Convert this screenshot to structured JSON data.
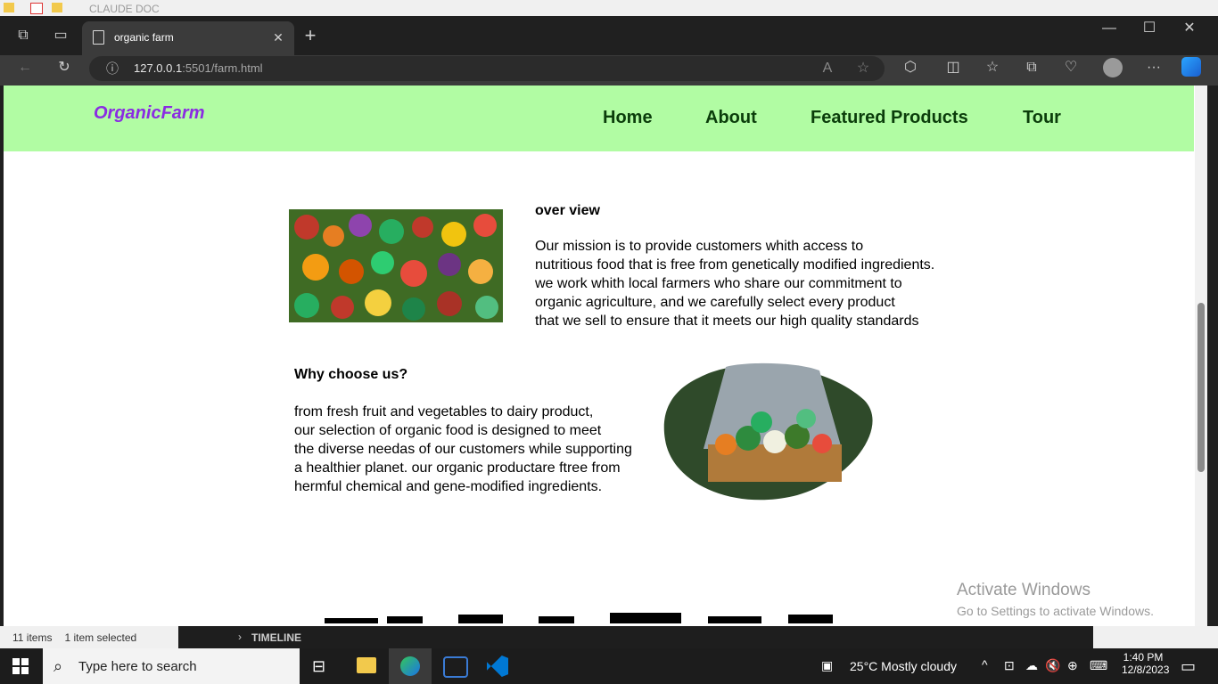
{
  "background_window": {
    "title": "CLAUDE DOC",
    "status": {
      "items": "11 items",
      "selected": "1 item selected"
    },
    "editor_panel": "TIMELINE"
  },
  "browser": {
    "tab": {
      "title": "organic farm"
    },
    "address": {
      "host": "127.0.0.1",
      "rest": ":5501/farm.html"
    }
  },
  "site": {
    "brand": "OrganicFarm",
    "nav": [
      "Home",
      "About",
      "Featured Products",
      "Tour"
    ],
    "overview": {
      "heading": "over view",
      "lines": [
        "Our mission is to provide customers whith access to",
        "nutritious food that is free from genetically modified ingredients.",
        "we work whith local farmers who share our commitment to",
        "organic agriculture, and we carefully select every product",
        "that we sell to ensure that it meets our high quality standards"
      ]
    },
    "why": {
      "heading": "Why choose us?",
      "lines": [
        "from fresh fruit and vegetables to dairy product,",
        "our selection of organic food is designed to meet",
        "the diverse needas of our customers while supporting",
        "a healthier planet. our organic productare ftree from",
        "hermful chemical and gene-modified ingredients."
      ]
    }
  },
  "watermark": {
    "line1": "Activate Windows",
    "line2": "Go to Settings to activate Windows."
  },
  "taskbar": {
    "search_placeholder": "Type here to search",
    "weather": "25°C  Mostly cloudy",
    "time": "1:40 PM",
    "date": "12/8/2023"
  }
}
